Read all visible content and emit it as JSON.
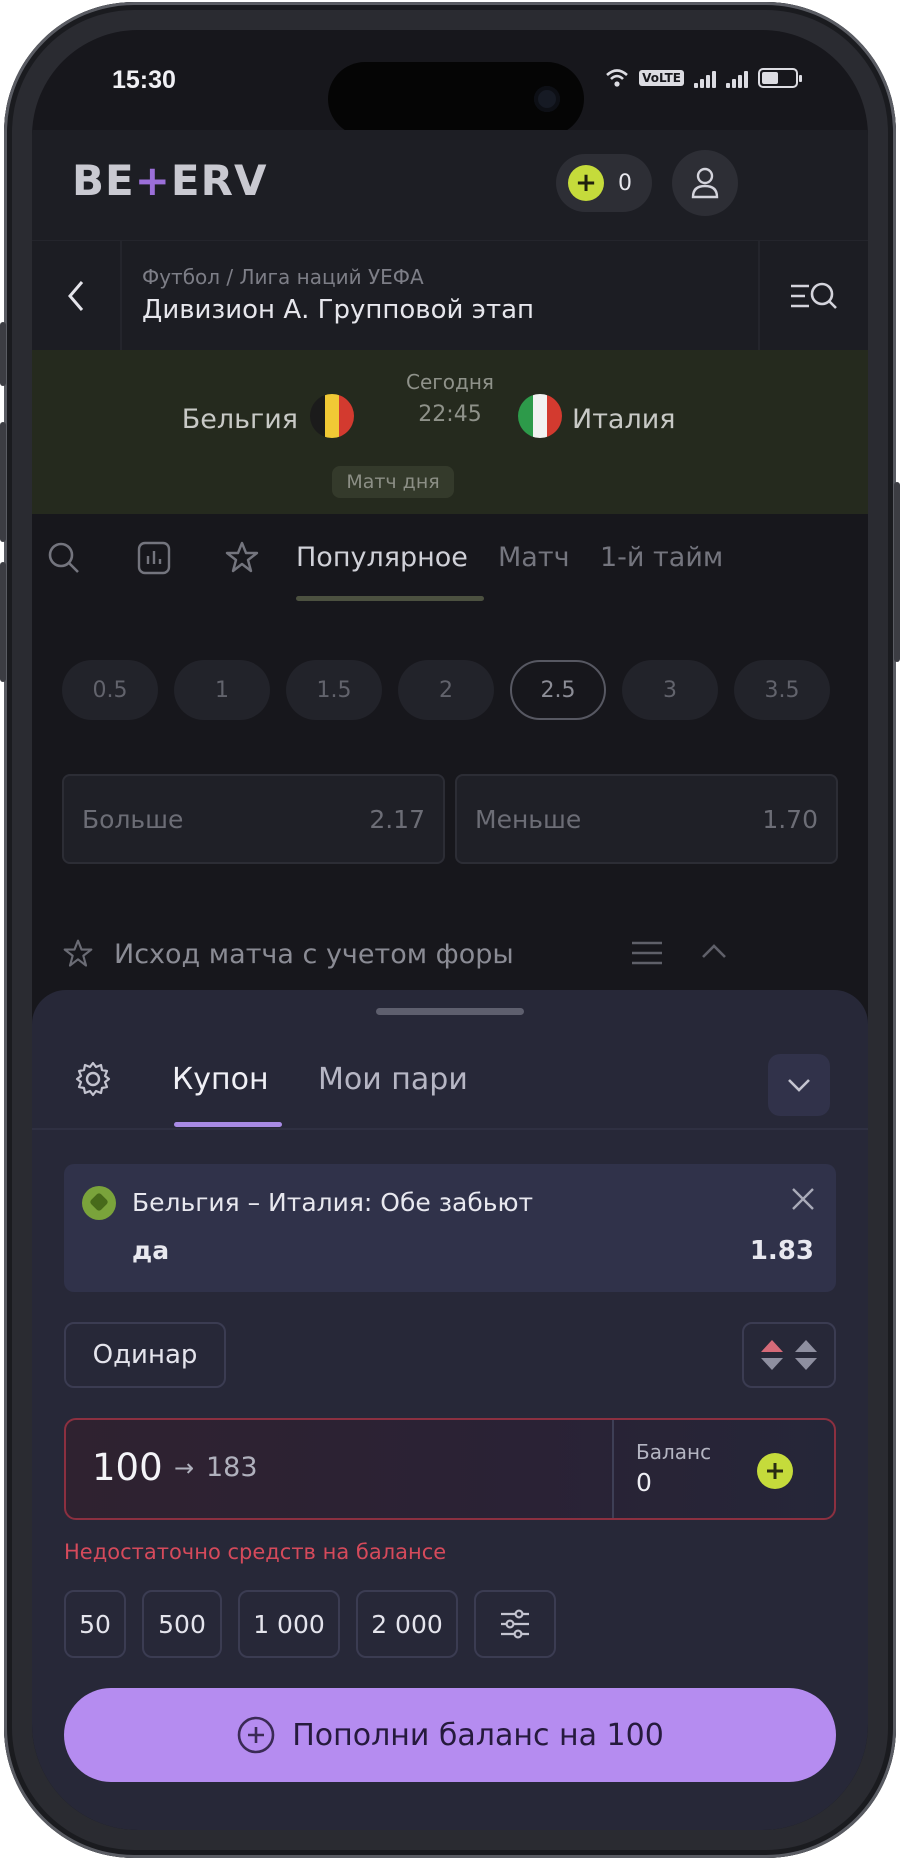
{
  "status_bar": {
    "time": "15:30",
    "network_badge": "VoLTE"
  },
  "header": {
    "logo_text_left": "BE",
    "logo_mark": "+",
    "logo_text_right": "ERV",
    "balance": "0",
    "coin_icon_glyph": "+"
  },
  "breadcrumb": {
    "subtitle": "Футбол / Лига наций УЕФА",
    "title": "Дивизион А. Групповой этап"
  },
  "match": {
    "team_home": "Бельгия",
    "team_away": "Италия",
    "day": "Сегодня",
    "time": "22:45",
    "badge": "Матч дня",
    "flag_be_colors": [
      "#1b1b1b",
      "#f1c935",
      "#d33a2f"
    ],
    "flag_it_colors": [
      "#2d9a4a",
      "#f2f2f2",
      "#d33a2f"
    ]
  },
  "tabs": {
    "items": [
      "Популярное",
      "Матч",
      "1-й тайм"
    ],
    "active": "Популярное"
  },
  "totals": {
    "chips": [
      "0.5",
      "1",
      "1.5",
      "2",
      "2.5",
      "3",
      "3.5"
    ],
    "selected": "2.5",
    "over_label": "Больше",
    "over_odds": "2.17",
    "under_label": "Меньше",
    "under_odds": "1.70"
  },
  "market": {
    "title": "Исход матча с учетом форы"
  },
  "coupon": {
    "tab_active": "Купон",
    "tab_other": "Мои пари",
    "bet": {
      "name": "Бельгия – Италия: Обе забьют",
      "selection": "да",
      "odds": "1.83"
    },
    "bet_type": "Одинар",
    "stake": "100",
    "arrow": "→",
    "potential_win": "183",
    "balance_label": "Баланс",
    "balance_value": "0",
    "error": "Недостаточно средств на балансе",
    "quick_amounts": [
      "50",
      "500",
      "1 000",
      "2 000"
    ],
    "deposit_button": "Пополни баланс на 100"
  },
  "colors": {
    "accent_purple": "#b58cf0",
    "coin_green": "#c5db3b",
    "error_red": "#d54a5b"
  }
}
